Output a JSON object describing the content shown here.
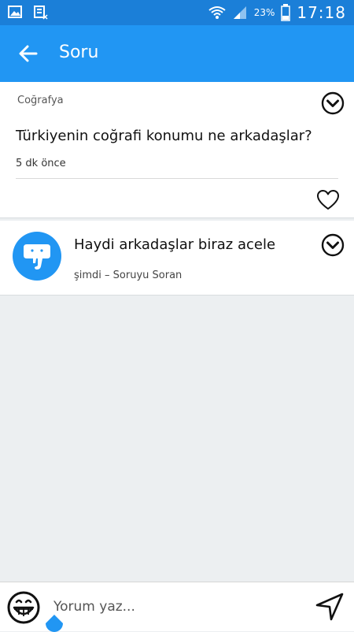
{
  "status_bar": {
    "battery_percent": "23%",
    "time": "17:18",
    "icons": [
      "gallery-icon",
      "sim-card-icon",
      "wifi-icon",
      "signal-icon",
      "battery-icon"
    ]
  },
  "app_bar": {
    "title": "Soru",
    "back_icon": "arrow-left-icon"
  },
  "question": {
    "category": "Coğrafya",
    "text": "Türkiyenin coğrafi konumu ne arkadaşlar?",
    "time": "5 dk önce",
    "menu_icon": "chevron-down-circle-icon",
    "like_icon": "heart-outline-icon"
  },
  "answers": [
    {
      "avatar_icon": "elephant-icon",
      "text": "Haydi arkadaşlar biraz acele",
      "meta": "şimdi – Soruyu Soran",
      "menu_icon": "chevron-down-circle-icon"
    }
  ],
  "comment_bar": {
    "placeholder": "Yorum yaz...",
    "emoji_icon": "grin-emoji-icon",
    "send_icon": "send-navigation-icon"
  },
  "colors": {
    "status_bar": "#1b7fd8",
    "app_bar": "#2196f3",
    "background": "#eceff1",
    "avatar": "#2196f3"
  }
}
